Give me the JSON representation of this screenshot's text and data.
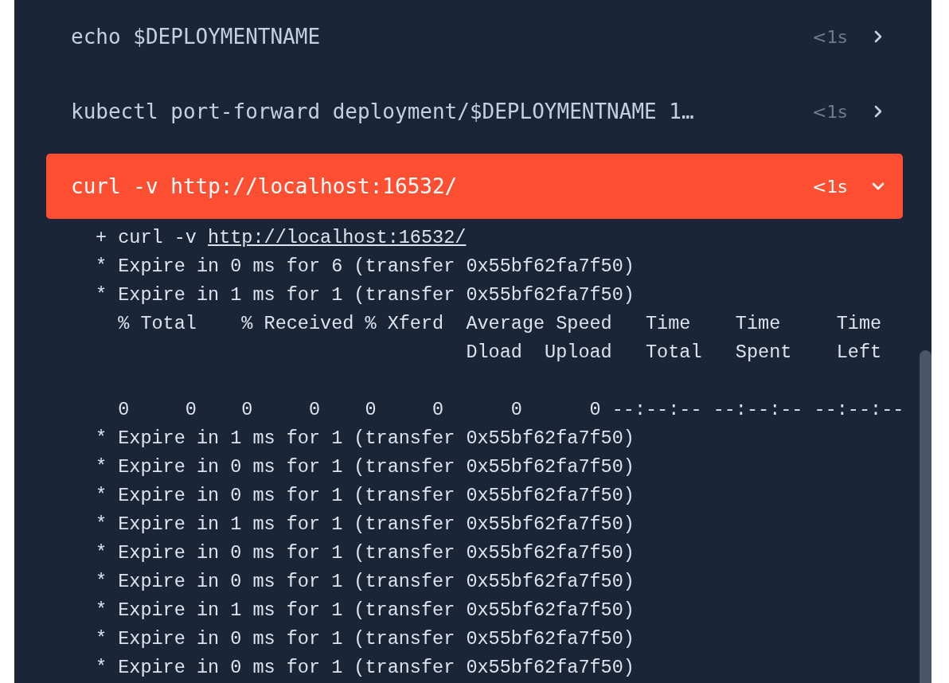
{
  "steps": [
    {
      "command": "echo $DEPLOYMENTNAME",
      "duration": "<1s",
      "expanded": false,
      "selected": false
    },
    {
      "command": "kubectl port-forward deployment/$DEPLOYMENTNAME 1…",
      "duration": "<1s",
      "expanded": false,
      "selected": false
    },
    {
      "command": "curl -v http://localhost:16532/",
      "duration": "<1s",
      "expanded": true,
      "selected": true,
      "log": [
        {
          "kind": "command",
          "prefix": "+ curl -v ",
          "link": "http://localhost:16532/"
        },
        {
          "kind": "plain",
          "text": "* Expire in 0 ms for 6 (transfer 0x55bf62fa7f50)"
        },
        {
          "kind": "plain",
          "text": "* Expire in 1 ms for 1 (transfer 0x55bf62fa7f50)"
        },
        {
          "kind": "plain",
          "text": "  % Total    % Received % Xferd  Average Speed   Time    Time     Time"
        },
        {
          "kind": "plain",
          "text": "                                 Dload  Upload   Total   Spent    Left"
        },
        {
          "kind": "progress",
          "text": "  0     0    0     0    0     0      0      0 --:--:-- --:--:-- --:--:--"
        },
        {
          "kind": "plain",
          "text": "* Expire in 1 ms for 1 (transfer 0x55bf62fa7f50)"
        },
        {
          "kind": "plain",
          "text": "* Expire in 0 ms for 1 (transfer 0x55bf62fa7f50)"
        },
        {
          "kind": "plain",
          "text": "* Expire in 0 ms for 1 (transfer 0x55bf62fa7f50)"
        },
        {
          "kind": "plain",
          "text": "* Expire in 1 ms for 1 (transfer 0x55bf62fa7f50)"
        },
        {
          "kind": "plain",
          "text": "* Expire in 0 ms for 1 (transfer 0x55bf62fa7f50)"
        },
        {
          "kind": "plain",
          "text": "* Expire in 0 ms for 1 (transfer 0x55bf62fa7f50)"
        },
        {
          "kind": "plain",
          "text": "* Expire in 1 ms for 1 (transfer 0x55bf62fa7f50)"
        },
        {
          "kind": "plain",
          "text": "* Expire in 0 ms for 1 (transfer 0x55bf62fa7f50)"
        },
        {
          "kind": "plain",
          "text": "* Expire in 0 ms for 1 (transfer 0x55bf62fa7f50)"
        }
      ]
    }
  ]
}
